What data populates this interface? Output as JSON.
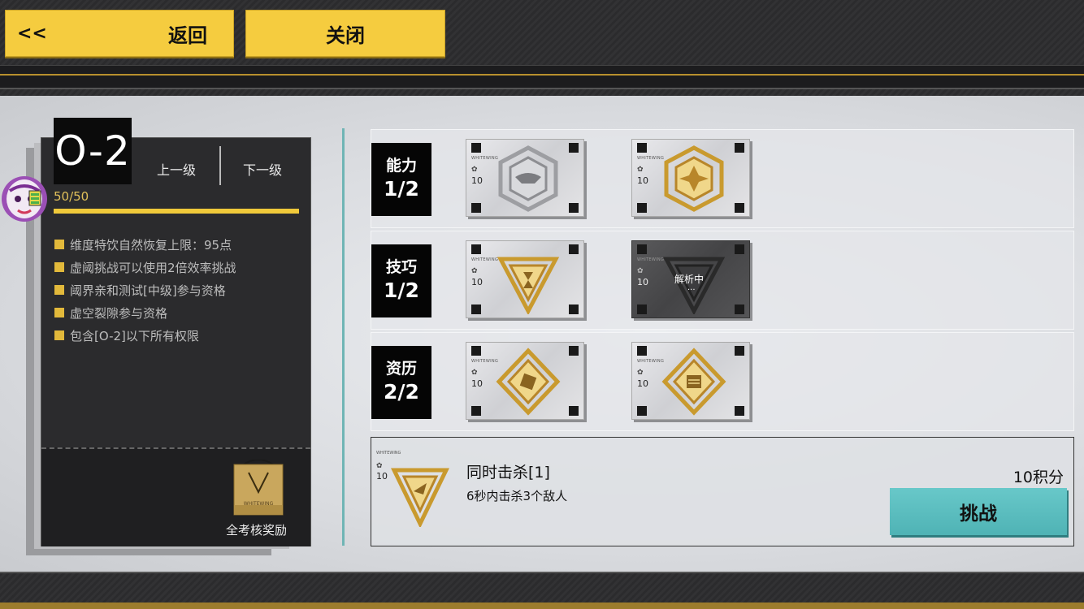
{
  "header": {
    "back_arrows": "<<",
    "back_label": "返回",
    "close_label": "关闭"
  },
  "rank": {
    "current": "O-2",
    "prev_label": "上一级",
    "next_label": "下一级",
    "progress_text": "50/50",
    "progress_fraction": 1.0
  },
  "perks": [
    "维度特饮自然恢复上限：95点",
    "虚阈挑战可以使用2倍效率挑战",
    "阈界亲和测试[中级]参与资格",
    "虚空裂隙参与资格",
    "包含[O-2]以下所有权限"
  ],
  "reward": {
    "label": "全考核奖励",
    "bag_text": "WHITEWING"
  },
  "rows": [
    {
      "name": "能力",
      "count": "1/2",
      "cards": [
        {
          "brand": "WHITEWING",
          "points": "10",
          "emblem": "silver-hexagon-emblem",
          "color": "#a9aaae",
          "dark": false,
          "status": ""
        },
        {
          "brand": "WHITEWING",
          "points": "10",
          "emblem": "gold-hexagon-emblem",
          "color": "#d4a93c",
          "dark": false,
          "status": ""
        }
      ]
    },
    {
      "name": "技巧",
      "count": "1/2",
      "cards": [
        {
          "brand": "WHITEWING",
          "points": "10",
          "emblem": "gold-triangle-emblem",
          "color": "#d4a93c",
          "dark": false,
          "status": ""
        },
        {
          "brand": "WHITEWING",
          "points": "10",
          "emblem": "locked-triangle-emblem",
          "color": "#2a2a2a",
          "dark": true,
          "status": "解析中",
          "status_dots": "..."
        }
      ]
    },
    {
      "name": "资历",
      "count": "2/2",
      "cards": [
        {
          "brand": "WHITEWING",
          "points": "10",
          "emblem": "gold-diamond-emblem",
          "color": "#d4a93c",
          "dark": false,
          "status": ""
        },
        {
          "brand": "WHITEWING",
          "points": "10",
          "emblem": "gold-diamond-emblem",
          "color": "#d4a93c",
          "dark": false,
          "status": ""
        }
      ]
    }
  ],
  "challenge": {
    "brand": "WHITEWING",
    "points": "10",
    "title": "同时击杀[1]",
    "description": "6秒内击杀3个敌人",
    "score": "10积分",
    "button_label": "挑战"
  },
  "colors": {
    "accent_yellow": "#f5cc3f",
    "accent_teal": "#5bbdbe",
    "gold": "#d4a93c"
  }
}
